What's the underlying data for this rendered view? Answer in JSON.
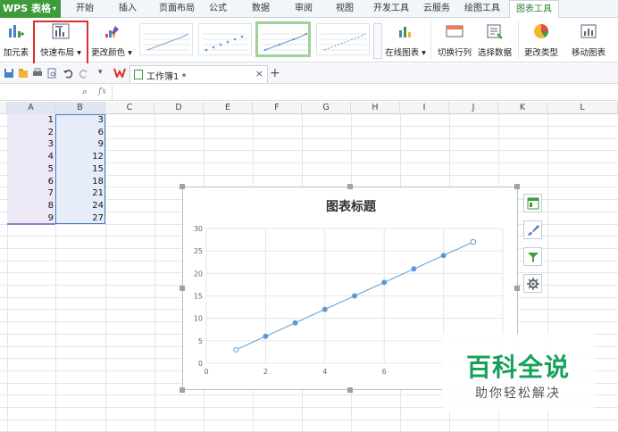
{
  "app": {
    "name": "WPS 表格"
  },
  "menu_tabs": [
    "开始",
    "插入",
    "页面布局",
    "公式",
    "数据",
    "审阅",
    "视图",
    "开发工具",
    "云服务",
    "绘图工具",
    "图表工具"
  ],
  "ribbon": {
    "add_element": "加元素",
    "quick_layout": "快速布局",
    "change_color": "更改颜色",
    "online_chart": "在线图表",
    "switch_row_col": "切换行列",
    "select_data": "选择数据",
    "change_type": "更改类型",
    "move_chart": "移动图表"
  },
  "document": {
    "tab_name": "工作簿1 *"
  },
  "formula_bar": {
    "fx": "fx"
  },
  "columns": [
    "A",
    "B",
    "C",
    "D",
    "E",
    "F",
    "G",
    "H",
    "I",
    "J",
    "K",
    "L"
  ],
  "rows": [
    {
      "a": "1",
      "b": "3"
    },
    {
      "a": "2",
      "b": "6"
    },
    {
      "a": "3",
      "b": "9"
    },
    {
      "a": "4",
      "b": "12"
    },
    {
      "a": "5",
      "b": "15"
    },
    {
      "a": "6",
      "b": "18"
    },
    {
      "a": "7",
      "b": "21"
    },
    {
      "a": "8",
      "b": "24"
    },
    {
      "a": "9",
      "b": "27"
    }
  ],
  "chart_data": {
    "type": "scatter",
    "title": "图表标题",
    "x": [
      1,
      2,
      3,
      4,
      5,
      6,
      7,
      8,
      9
    ],
    "y": [
      3,
      6,
      9,
      12,
      15,
      18,
      21,
      24,
      27
    ],
    "xlim": [
      0,
      10
    ],
    "ylim": [
      0,
      30
    ],
    "x_ticks": [
      "0",
      "2",
      "4",
      "6"
    ],
    "y_ticks": [
      "0",
      "5",
      "10",
      "15",
      "20",
      "25",
      "30"
    ],
    "grid": true,
    "line_color": "#5b9bd5"
  },
  "side_tools": [
    "chart-elements-icon",
    "chart-style-icon",
    "chart-filter-icon",
    "chart-settings-icon"
  ],
  "watermark": {
    "title": "百科全说",
    "subtitle": "助你轻松解决"
  },
  "colors": {
    "accent": "#3f9a3c",
    "highlight": "#d9312b"
  }
}
